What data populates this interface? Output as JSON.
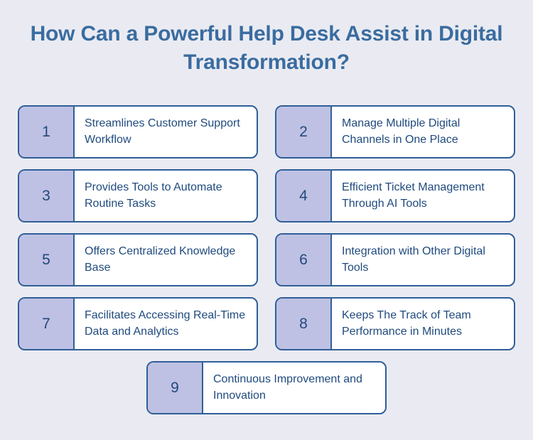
{
  "colors": {
    "background": "#eaebf2",
    "title_text": "#3a6ca0",
    "card_border": "#2f5f99",
    "card_background": "#ffffff",
    "badge_background": "#bec1e3",
    "badge_number_text": "#23497c",
    "card_body_text": "#1f4a7d"
  },
  "header": {
    "title": "How Can a Powerful Help Desk Assist in Digital Transformation?"
  },
  "rows": [
    {
      "cards": [
        {
          "number": "1",
          "text": "Streamlines Customer Support Workflow"
        },
        {
          "number": "2",
          "text": "Manage Multiple Digital Channels in One Place"
        }
      ]
    },
    {
      "cards": [
        {
          "number": "3",
          "text": "Provides Tools to Automate Routine Tasks"
        },
        {
          "number": "4",
          "text": "Efficient Ticket Management Through AI Tools"
        }
      ]
    },
    {
      "cards": [
        {
          "number": "5",
          "text": "Offers Centralized Knowledge Base"
        },
        {
          "number": "6",
          "text": "Integration with Other Digital Tools"
        }
      ]
    },
    {
      "cards": [
        {
          "number": "7",
          "text": "Facilitates Accessing Real-Time Data and Analytics"
        },
        {
          "number": "8",
          "text": "Keeps The Track of Team Performance in Minutes"
        }
      ]
    },
    {
      "cards": [
        {
          "number": "9",
          "text": "Continuous Improvement and Innovation"
        }
      ]
    }
  ]
}
